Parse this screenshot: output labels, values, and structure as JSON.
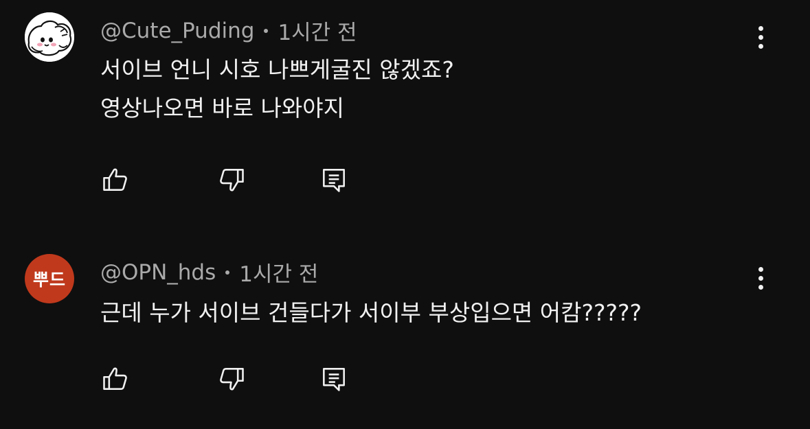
{
  "comments": [
    {
      "author": "@Cute_Puding",
      "time": "1시간 전",
      "lines": [
        "서이브 언니 시호 나쁘게굴진 않겠죠?",
        "영상나오면 바로 나와야지"
      ],
      "avatar_icon": "cartoon-dog-avatar"
    },
    {
      "author": "@OPN_hds",
      "time": "1시간 전",
      "lines": [
        "근데 누가 서이브 건들다가 서이부 부상입으면 어캄?????"
      ],
      "avatar_text": "뿌드",
      "avatar_color": "#c0391c"
    }
  ],
  "icons": {
    "like": "thumb-up-icon",
    "dislike": "thumb-down-icon",
    "reply": "reply-comment-icon",
    "more": "more-vertical-icon"
  },
  "colors": {
    "background": "#0f0f0f",
    "text": "#f1f1f1",
    "meta": "#aaaaaa"
  }
}
